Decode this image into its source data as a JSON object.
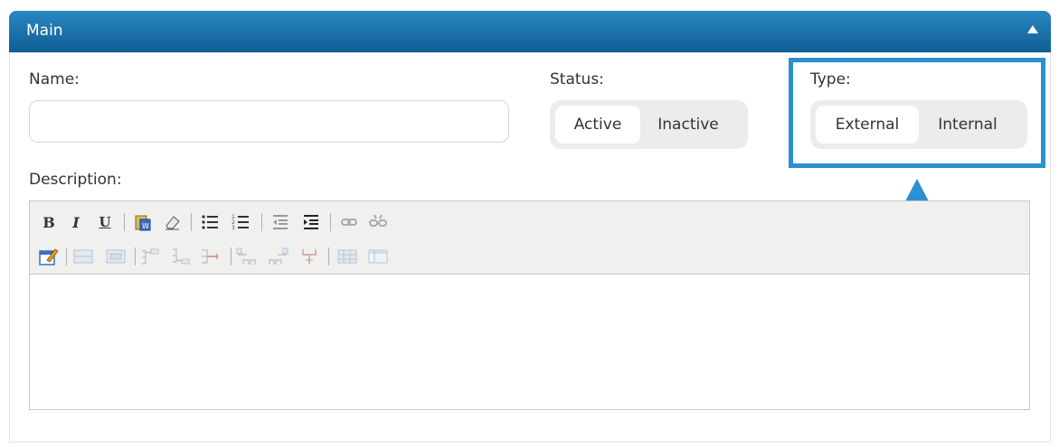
{
  "panel": {
    "title": "Main"
  },
  "form": {
    "name_label": "Name:",
    "name_value": "",
    "status_label": "Status:",
    "status_options": [
      "Active",
      "Inactive"
    ],
    "status_selected": "Active",
    "type_label": "Type:",
    "type_options": [
      "External",
      "Internal"
    ],
    "type_selected": "External",
    "description_label": "Description:"
  },
  "toolbar_row1": [
    "bold",
    "italic",
    "underline",
    "paste-from-word",
    "clear-formatting",
    "bulleted-list",
    "numbered-list",
    "outdent",
    "indent",
    "insert-link",
    "remove-link"
  ],
  "toolbar_row2": [
    "edit-html",
    "insert-row-before",
    "insert-row-after",
    "insert-column-before",
    "insert-column-after",
    "delete-column",
    "merge-cells-up",
    "merge-cells-down",
    "split-cell",
    "insert-table",
    "table-properties"
  ],
  "colors": {
    "header": "#1a73ab",
    "highlight": "#2b8fd0",
    "segment_bg": "#ececec"
  }
}
